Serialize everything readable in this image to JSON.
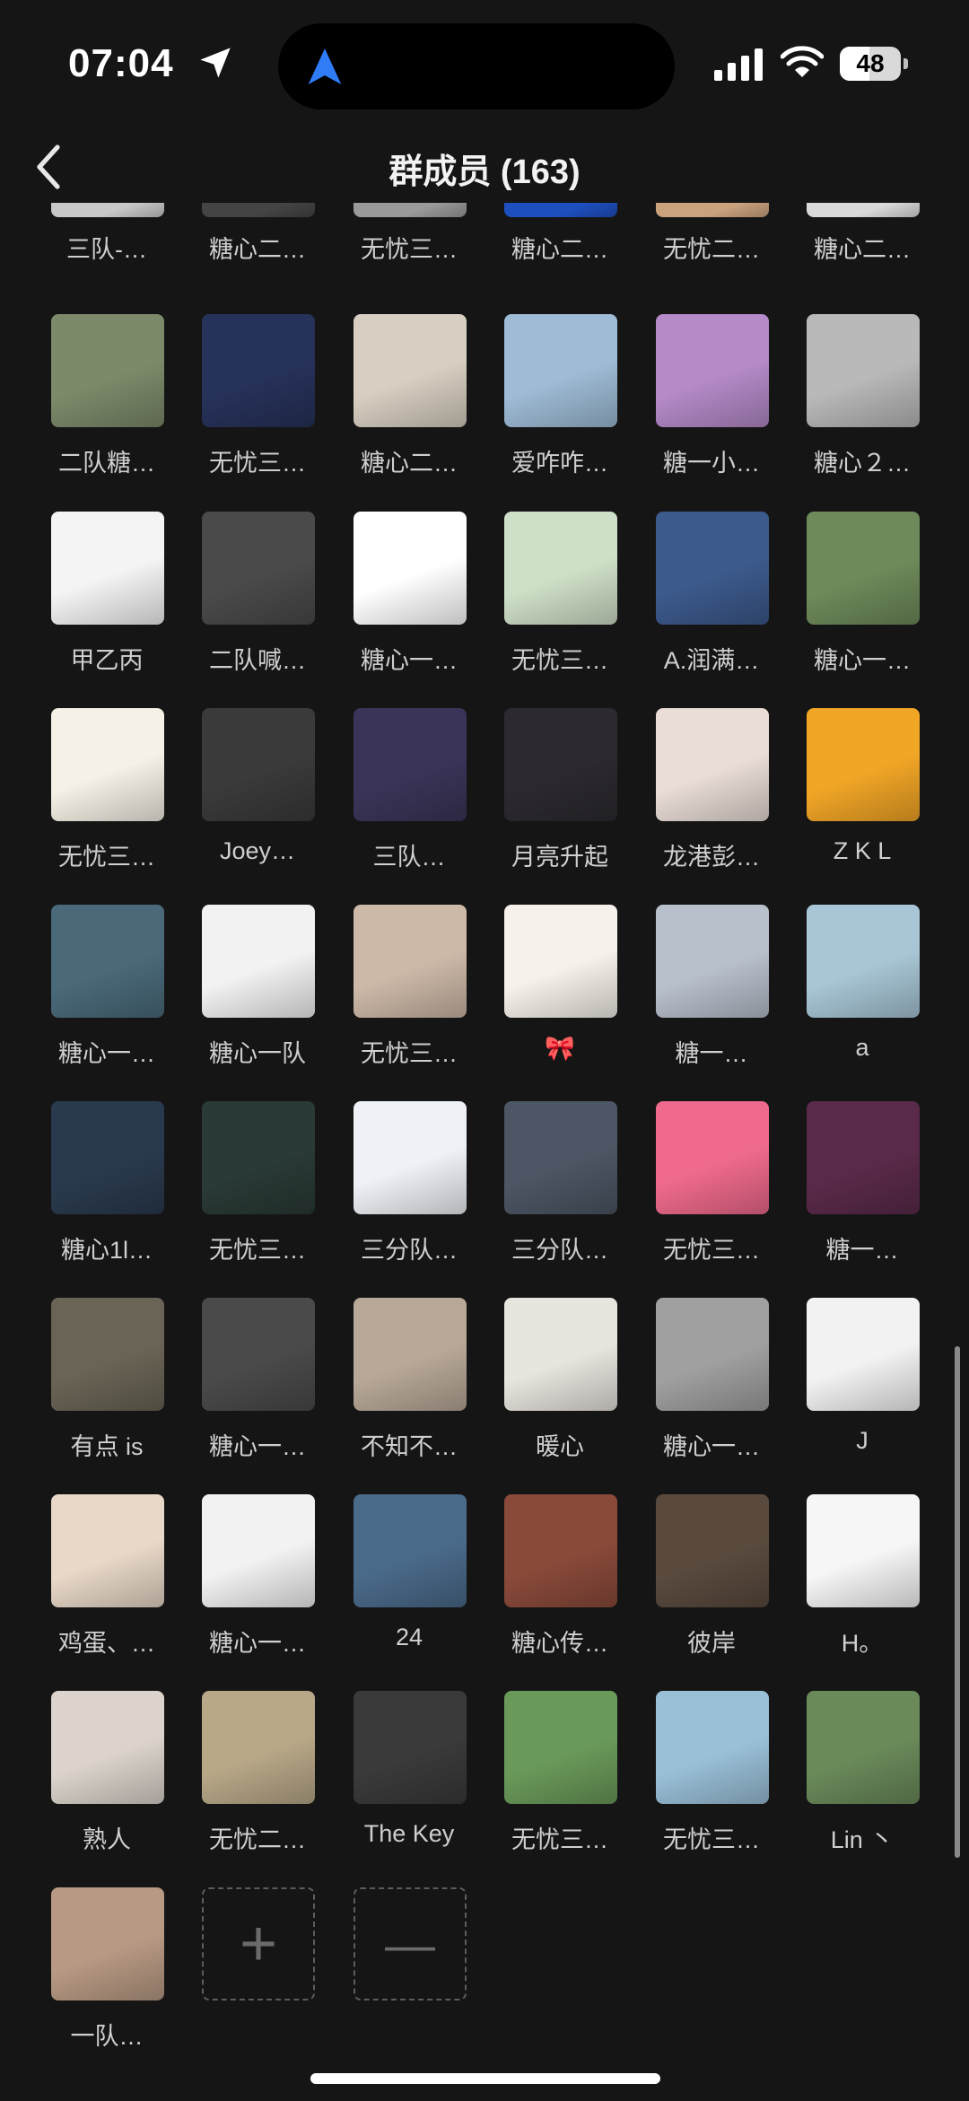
{
  "status": {
    "time": "07:04",
    "battery": "48",
    "battery_level": 0.48
  },
  "header": {
    "title": "群成员 (163)"
  },
  "members": [
    {
      "name": "三队-…",
      "color": "#c8c8c8"
    },
    {
      "name": "糖心二…",
      "color": "#444444"
    },
    {
      "name": "无忧三…",
      "color": "#9a9a9a"
    },
    {
      "name": "糖心二…",
      "color": "#1e4fbf"
    },
    {
      "name": "无忧二…",
      "color": "#caa27e"
    },
    {
      "name": "糖心二…",
      "color": "#d9d9d9"
    },
    {
      "name": "二队糖…",
      "color": "#7c8a6a"
    },
    {
      "name": "无忧三…",
      "color": "#27325a"
    },
    {
      "name": "糖心二…",
      "color": "#d8cfc2"
    },
    {
      "name": "爱咋咋…",
      "color": "#9ebcd6"
    },
    {
      "name": "糖一小…",
      "color": "#b48ac8"
    },
    {
      "name": "糖心２…",
      "color": "#b9b9b9"
    },
    {
      "name": "甲乙丙",
      "color": "#f4f4f4"
    },
    {
      "name": "二队喊…",
      "color": "#4a4a4a"
    },
    {
      "name": "糖心一…",
      "color": "#ffffff"
    },
    {
      "name": "无忧三…",
      "color": "#cfe0c8"
    },
    {
      "name": "A.润满…",
      "color": "#3c5a8c"
    },
    {
      "name": "糖心一…",
      "color": "#6e8a5a"
    },
    {
      "name": "无忧三…",
      "color": "#f6f1e6"
    },
    {
      "name": "Joey…",
      "color": "#3a3a3a"
    },
    {
      "name": "三队…",
      "color": "#3a3558"
    },
    {
      "name": "月亮升起",
      "color": "#2c2a30"
    },
    {
      "name": "龙港彭…",
      "color": "#e9ddd6"
    },
    {
      "name": "Z K L",
      "color": "#f2a626"
    },
    {
      "name": "糖心一…",
      "color": "#4a6a7a"
    },
    {
      "name": "糖心一队",
      "color": "#f2f2f2"
    },
    {
      "name": "无忧三…",
      "color": "#cdb9a8"
    },
    {
      "name": "🎀",
      "color": "#f6f1ea"
    },
    {
      "name": "糖一…",
      "color": "#b8c0cc"
    },
    {
      "name": "a",
      "color": "#a8c6d6"
    },
    {
      "name": "糖心1l…",
      "color": "#2a3a4e"
    },
    {
      "name": "无忧三…",
      "color": "#2a3a36"
    },
    {
      "name": "三分队…",
      "color": "#eef2f6"
    },
    {
      "name": "三分队…",
      "color": "#4c5664"
    },
    {
      "name": "无忧三…",
      "color": "#ef6a8c"
    },
    {
      "name": "糖一…",
      "color": "#5a2a4a"
    },
    {
      "name": "有点 is",
      "color": "#6a6456"
    },
    {
      "name": "糖心一…",
      "color": "#4a4a4a"
    },
    {
      "name": "不知不…",
      "color": "#b8a898"
    },
    {
      "name": "暖心",
      "color": "#e8e4de"
    },
    {
      "name": "糖心一…",
      "color": "#a0a0a0"
    },
    {
      "name": "J",
      "color": "#f2f2f2"
    },
    {
      "name": "鸡蛋、…",
      "color": "#e8d8c8"
    },
    {
      "name": "糖心一…",
      "color": "#f2f2f2"
    },
    {
      "name": "24",
      "color": "#4a6a8a"
    },
    {
      "name": "糖心传…",
      "color": "#8a4a3a"
    },
    {
      "name": "彼岸",
      "color": "#5a4a3e"
    },
    {
      "name": "H。",
      "color": "#f6f6f6"
    },
    {
      "name": "熟人",
      "color": "#dcd4cc"
    },
    {
      "name": "无忧二…",
      "color": "#b8a888"
    },
    {
      "name": "The Key",
      "color": "#3a3a3a"
    },
    {
      "name": "无忧三…",
      "color": "#6a9a5a"
    },
    {
      "name": "无忧三…",
      "color": "#9ac0d8"
    },
    {
      "name": "Lin 丶",
      "color": "#6a8a5a"
    },
    {
      "name": "一队…",
      "color": "#b89a84"
    }
  ],
  "actions": {
    "add_symbol": "+",
    "remove_symbol": "—"
  }
}
